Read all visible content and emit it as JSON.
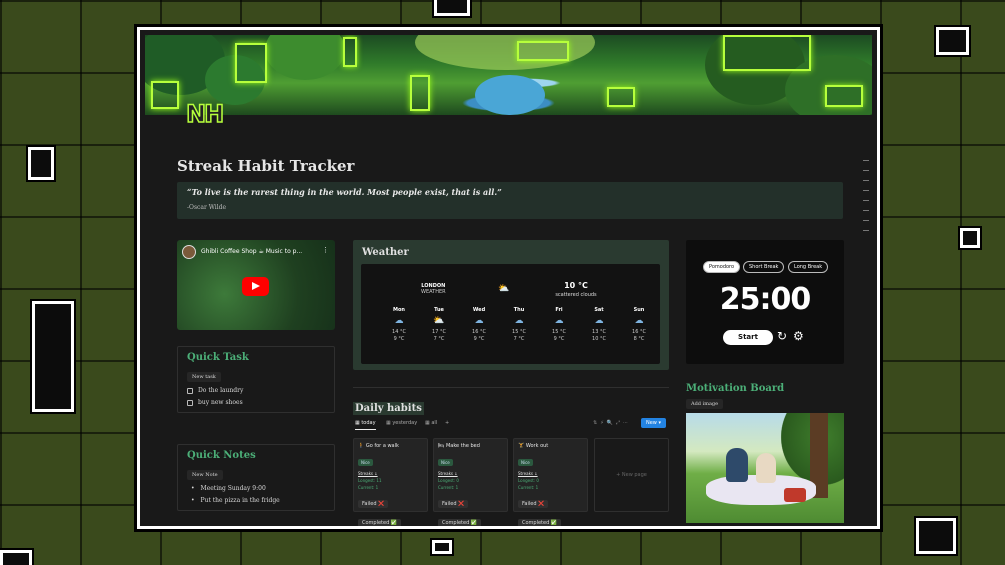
{
  "page": {
    "title": "Streak Habit Tracker",
    "logo_text": "NH"
  },
  "quote": {
    "text": "“To live is the rarest thing in the world. Most people exist, that is all.”",
    "author": "-Oscar Wilde"
  },
  "video": {
    "title": "Ghibli Coffee Shop ☕ Music to p...",
    "menu_icon": "more-vertical-icon"
  },
  "quick_task": {
    "title": "Quick Task",
    "new_label": "New task",
    "items": [
      {
        "label": "Do the laundry",
        "checked": false
      },
      {
        "label": "buy new shoes",
        "checked": false
      }
    ]
  },
  "quick_notes": {
    "title": "Quick Notes",
    "new_label": "New Note",
    "items": [
      "Meeting Sunday 9:00",
      "Put the pizza in the fridge"
    ]
  },
  "weather": {
    "title": "Weather",
    "city": "LONDON",
    "city_sub": "WEATHER",
    "current_temp": "10 °C",
    "current_desc": "scattered clouds",
    "current_icon": "partly-cloudy-icon",
    "days": [
      {
        "name": "Mon",
        "high": "14 °C",
        "low": "9 °C",
        "icon": "rain-icon"
      },
      {
        "name": "Tue",
        "high": "17 °C",
        "low": "7 °C",
        "icon": "sun-rain-icon"
      },
      {
        "name": "Wed",
        "high": "16 °C",
        "low": "9 °C",
        "icon": "rain-icon"
      },
      {
        "name": "Thu",
        "high": "15 °C",
        "low": "7 °C",
        "icon": "rain-icon"
      },
      {
        "name": "Fri",
        "high": "15 °C",
        "low": "9 °C",
        "icon": "rain-icon"
      },
      {
        "name": "Sat",
        "high": "13 °C",
        "low": "10 °C",
        "icon": "rain-icon"
      },
      {
        "name": "Sun",
        "high": "16 °C",
        "low": "8 °C",
        "icon": "rain-icon"
      }
    ]
  },
  "daily_habits": {
    "title": "Daily habits",
    "tabs": [
      "today",
      "yesterday",
      "all"
    ],
    "new_label": "New",
    "new_page_label": "+ New page",
    "habits": [
      {
        "name": "Go for a walk",
        "tag": "Nice",
        "streaks": "Streaks ↓",
        "longest": "Longest: 11",
        "current": "Current: 1",
        "failed": "Failed ❌",
        "completed": "Completed ✅"
      },
      {
        "name": "Make the bed",
        "tag": "Nice",
        "streaks": "Streaks ↓",
        "longest": "Longest: 0",
        "current": "Current: 1",
        "failed": "Failed ❌",
        "completed": "Completed ✅"
      },
      {
        "name": "Work out",
        "tag": "Nice",
        "streaks": "Streaks ↓",
        "longest": "Longest: 0",
        "current": "Current: 1",
        "failed": "Failed ❌",
        "completed": "Completed ✅"
      }
    ]
  },
  "timer": {
    "modes": [
      "Pomodoro",
      "Short Break",
      "Long Break"
    ],
    "selected_mode": "Pomodoro",
    "time": "25:00",
    "start_label": "Start",
    "reset_icon": "reset-icon",
    "settings_icon": "gear-icon"
  },
  "motivation_board": {
    "title": "Motivation Board",
    "add_label": "Add image"
  },
  "colors": {
    "accent_green": "#4caf78",
    "neon": "#b7ff3c",
    "button_blue": "#2383e2"
  }
}
